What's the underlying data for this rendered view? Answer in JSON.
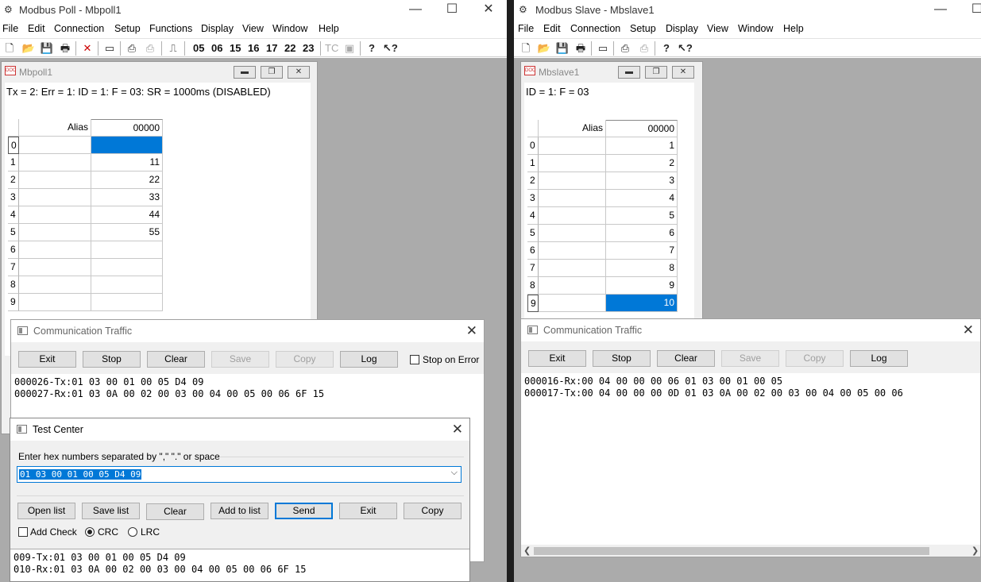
{
  "poll": {
    "title": "Modbus Poll - Mbpoll1",
    "menu": [
      "File",
      "Edit",
      "Connection",
      "Setup",
      "Functions",
      "Display",
      "View",
      "Window",
      "Help"
    ],
    "toolbar_codes": [
      "05",
      "06",
      "15",
      "16",
      "17",
      "22",
      "23"
    ],
    "toolbar_tc": "TC",
    "child": {
      "title": "Mbpoll1",
      "status": "Tx = 2: Err = 1: ID = 1: F = 03: SR = 1000ms  (DISABLED)",
      "col_alias": "Alias",
      "col_addr": "00000",
      "rows": [
        {
          "idx": "0",
          "value": ""
        },
        {
          "idx": "1",
          "value": "11"
        },
        {
          "idx": "2",
          "value": "22"
        },
        {
          "idx": "3",
          "value": "33"
        },
        {
          "idx": "4",
          "value": "44"
        },
        {
          "idx": "5",
          "value": "55"
        },
        {
          "idx": "6",
          "value": ""
        },
        {
          "idx": "7",
          "value": ""
        },
        {
          "idx": "8",
          "value": ""
        },
        {
          "idx": "9",
          "value": ""
        }
      ]
    },
    "traffic": {
      "title": "Communication Traffic",
      "buttons": [
        "Exit",
        "Stop",
        "Clear",
        "Save",
        "Copy",
        "Log"
      ],
      "stop_on_error": "Stop on Error",
      "lines": [
        "000026-Tx:01 03 00 01 00 05 D4 09",
        "000027-Rx:01 03 0A 00 02 00 03 00 04 00 05 00 06 6F 15"
      ]
    },
    "test_center": {
      "title": "Test Center",
      "prompt": "Enter hex numbers separated by \",\"  \".\" or space",
      "input_value": "01 03 00 01 00 05 D4 09",
      "buttons": [
        "Open list",
        "Save list",
        "Clear",
        "Add to list",
        "Send",
        "Exit",
        "Copy"
      ],
      "add_check": "Add Check",
      "crc": "CRC",
      "lrc": "LRC",
      "lines": [
        "009-Tx:01 03 00 01 00 05 D4 09",
        "010-Rx:01 03 0A 00 02 00 03 00 04 00 05 00 06 6F 15"
      ]
    }
  },
  "slave": {
    "title": "Modbus Slave - Mbslave1",
    "menu": [
      "File",
      "Edit",
      "Connection",
      "Setup",
      "Display",
      "View",
      "Window",
      "Help"
    ],
    "child": {
      "title": "Mbslave1",
      "status": "ID = 1: F = 03",
      "col_alias": "Alias",
      "col_addr": "00000",
      "rows": [
        {
          "idx": "0",
          "value": "1"
        },
        {
          "idx": "1",
          "value": "2"
        },
        {
          "idx": "2",
          "value": "3"
        },
        {
          "idx": "3",
          "value": "4"
        },
        {
          "idx": "4",
          "value": "5"
        },
        {
          "idx": "5",
          "value": "6"
        },
        {
          "idx": "6",
          "value": "7"
        },
        {
          "idx": "7",
          "value": "8"
        },
        {
          "idx": "8",
          "value": "9"
        },
        {
          "idx": "9",
          "value": "10"
        }
      ]
    },
    "traffic": {
      "title": "Communication Traffic",
      "buttons": [
        "Exit",
        "Stop",
        "Clear",
        "Save",
        "Copy",
        "Log"
      ],
      "lines": [
        "000016-Rx:00 04 00 00 00 06 01 03 00 01 00 05",
        "000017-Tx:00 04 00 00 00 0D 01 03 0A 00 02 00 03 00 04 00 05 00 06"
      ]
    }
  }
}
